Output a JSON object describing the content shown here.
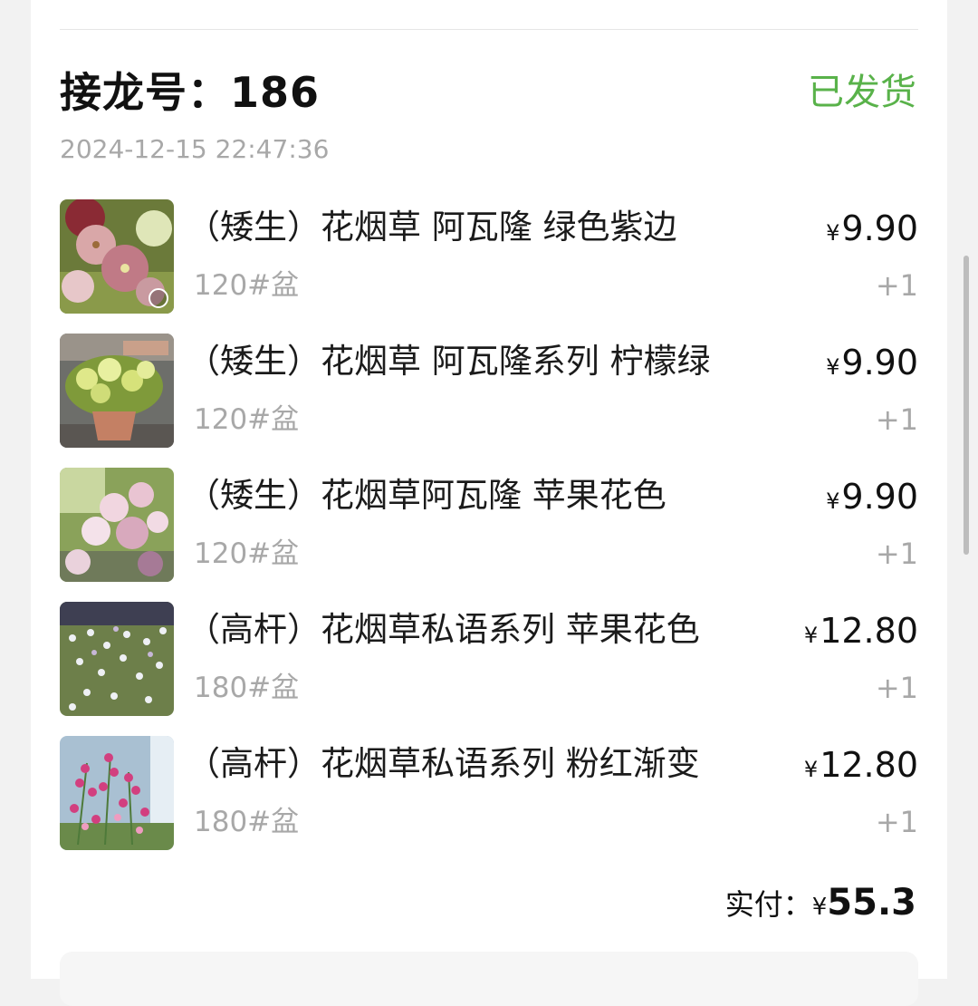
{
  "order": {
    "title": "接龙号：186",
    "status": "已发货",
    "time": "2024-12-15 22:47:36"
  },
  "items": [
    {
      "name": "（矮生）花烟草 阿瓦隆 绿色紫边",
      "spec": "120#盆",
      "currency": "¥",
      "price": "9.90",
      "qty": "+1"
    },
    {
      "name": "（矮生）花烟草 阿瓦隆系列 柠檬绿",
      "spec": "120#盆",
      "currency": "¥",
      "price": "9.90",
      "qty": "+1"
    },
    {
      "name": "（矮生）花烟草阿瓦隆 苹果花色",
      "spec": "120#盆",
      "currency": "¥",
      "price": "9.90",
      "qty": "+1"
    },
    {
      "name": "（高杆）花烟草私语系列 苹果花色",
      "spec": "180#盆",
      "currency": "¥",
      "price": "12.80",
      "qty": "+1"
    },
    {
      "name": "（高杆）花烟草私语系列 粉红渐变",
      "spec": "180#盆",
      "currency": "¥",
      "price": "12.80",
      "qty": "+1"
    }
  ],
  "total": {
    "label": "实付：",
    "currency": "¥",
    "amount": "55.3"
  },
  "colors": {
    "status_green": "#59b24a",
    "text_primary": "#111111",
    "text_secondary": "#a8a8a8"
  },
  "icons": {
    "scrollbar": "scrollbar-thumb",
    "thumb_badge": "leaf-badge-icon"
  }
}
